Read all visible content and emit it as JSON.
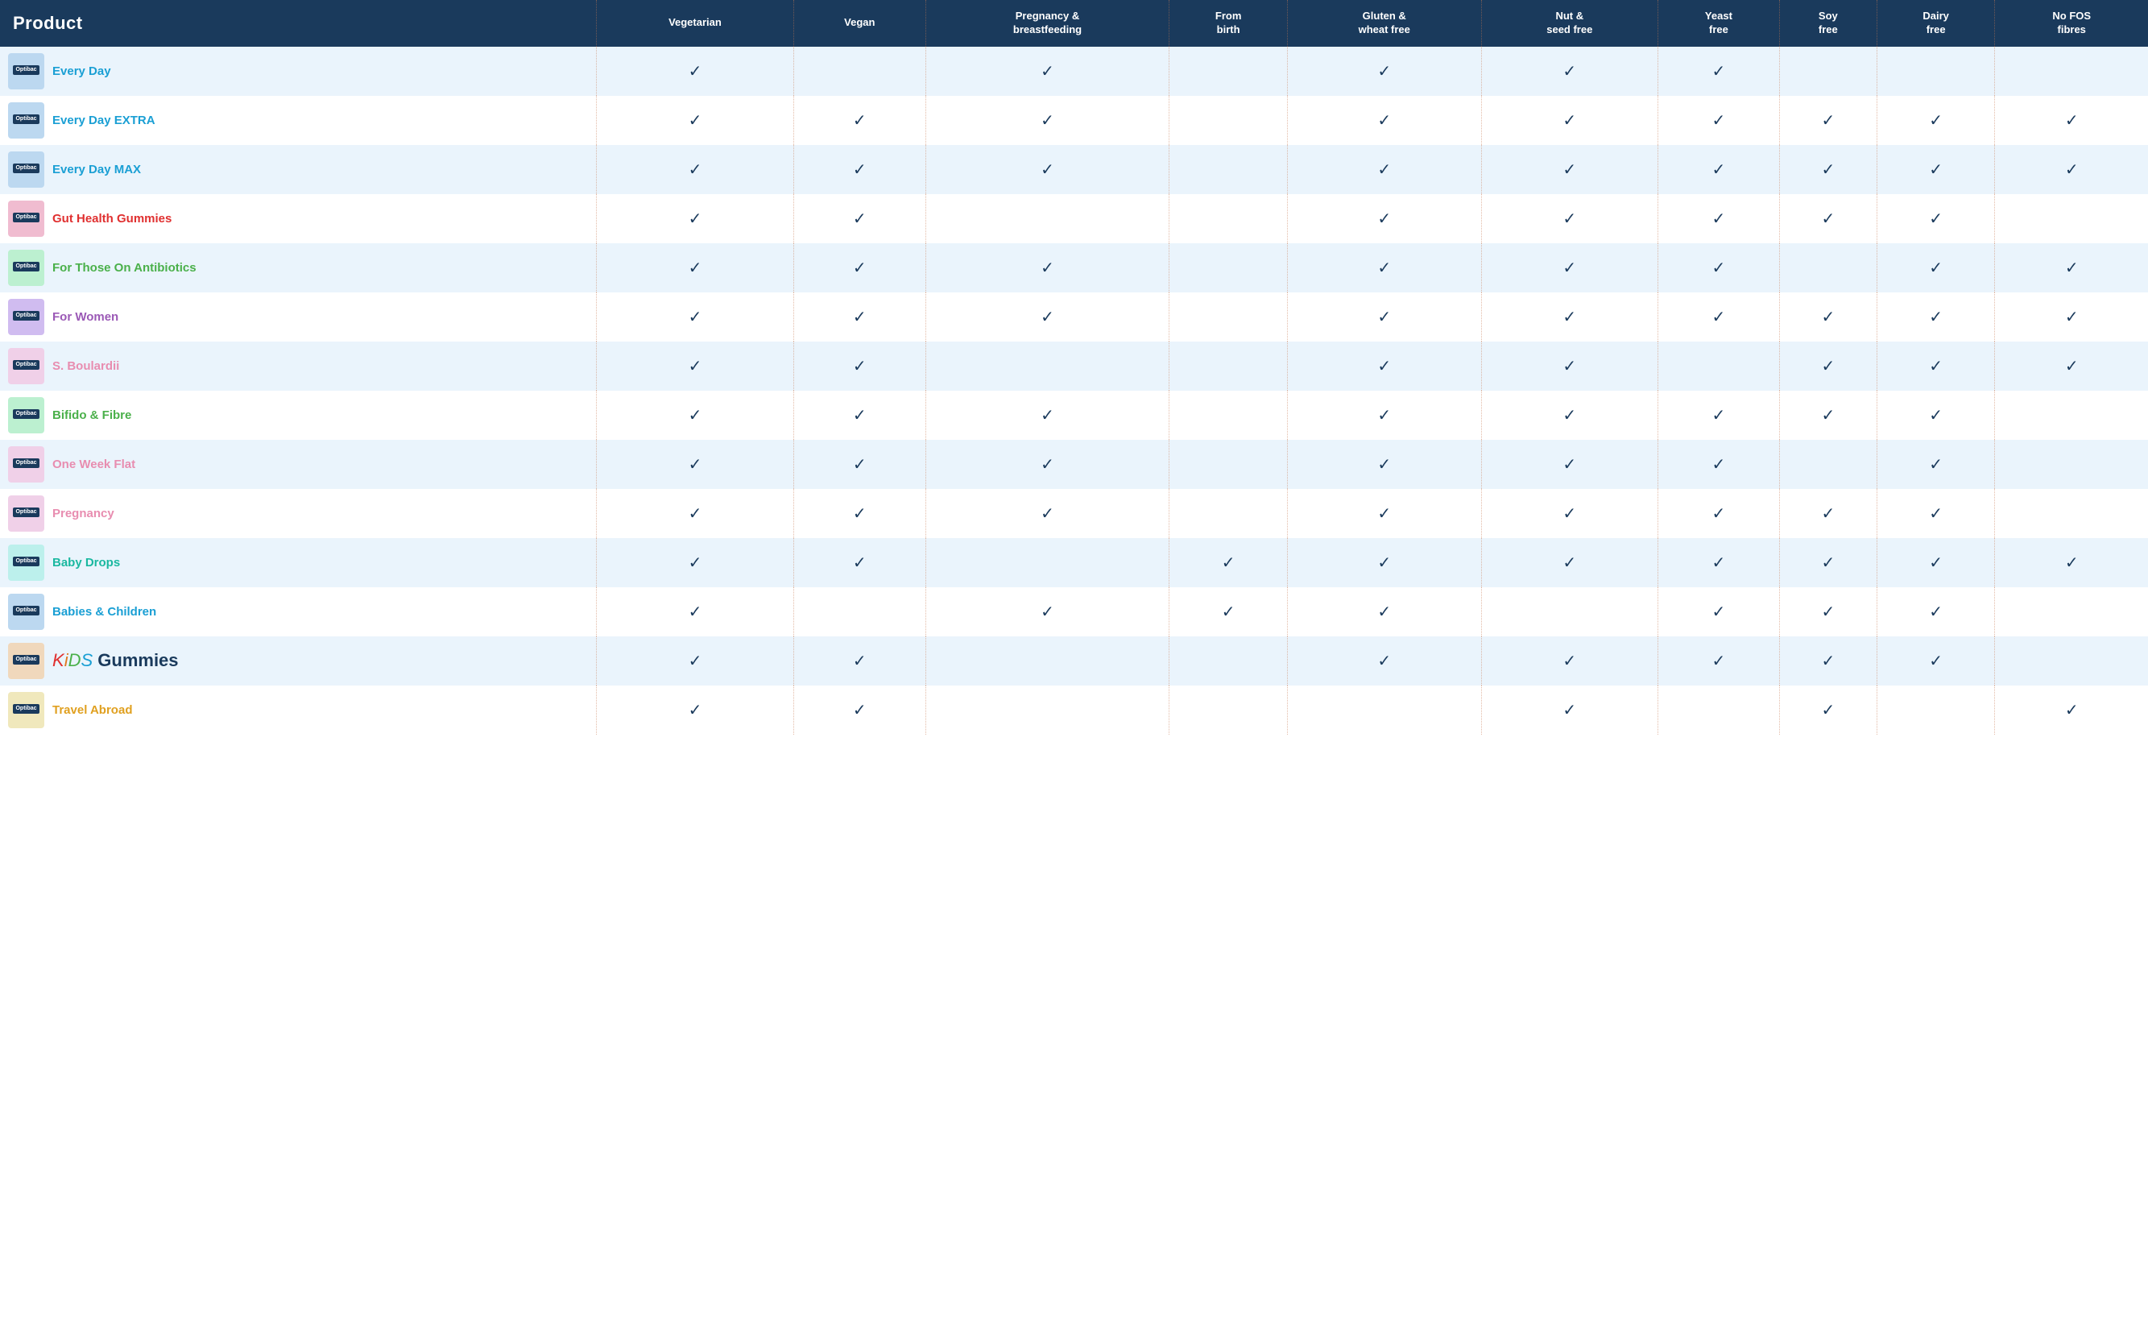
{
  "header": {
    "product_label": "Product",
    "columns": [
      {
        "key": "vegetarian",
        "label": "Vegetarian"
      },
      {
        "key": "vegan",
        "label": "Vegan"
      },
      {
        "key": "pregnancy",
        "label": "Pregnancy &\nbreastfeeding"
      },
      {
        "key": "from_birth",
        "label": "From\nbirth"
      },
      {
        "key": "gluten",
        "label": "Gluten &\nwheat free"
      },
      {
        "key": "nut",
        "label": "Nut &\nseed free"
      },
      {
        "key": "yeast",
        "label": "Yeast\nfree"
      },
      {
        "key": "soy",
        "label": "Soy\nfree"
      },
      {
        "key": "dairy",
        "label": "Dairy\nfree"
      },
      {
        "key": "fos",
        "label": "No FOS\nfibres"
      }
    ]
  },
  "products": [
    {
      "name": "Every Day",
      "color": "blue",
      "img_color": "blue",
      "vegetarian": true,
      "vegan": false,
      "pregnancy": true,
      "from_birth": false,
      "gluten": true,
      "nut": true,
      "yeast": true,
      "soy": false,
      "dairy": false,
      "fos": false
    },
    {
      "name": "Every Day EXTRA",
      "color": "blue",
      "img_color": "blue",
      "vegetarian": true,
      "vegan": true,
      "pregnancy": true,
      "from_birth": false,
      "gluten": true,
      "nut": true,
      "yeast": true,
      "soy": true,
      "dairy": true,
      "fos": true
    },
    {
      "name": "Every Day MAX",
      "color": "blue",
      "img_color": "blue",
      "vegetarian": true,
      "vegan": true,
      "pregnancy": true,
      "from_birth": false,
      "gluten": true,
      "nut": true,
      "yeast": true,
      "soy": true,
      "dairy": true,
      "fos": true
    },
    {
      "name": "Gut Health Gummies",
      "color": "red",
      "img_color": "red",
      "vegetarian": true,
      "vegan": true,
      "pregnancy": false,
      "from_birth": false,
      "gluten": true,
      "nut": true,
      "yeast": true,
      "soy": true,
      "dairy": true,
      "fos": false
    },
    {
      "name": "For Those On Antibiotics",
      "color": "green",
      "img_color": "green",
      "vegetarian": true,
      "vegan": true,
      "pregnancy": true,
      "from_birth": false,
      "gluten": true,
      "nut": true,
      "yeast": true,
      "soy": false,
      "dairy": true,
      "fos": true
    },
    {
      "name": "For Women",
      "color": "purple",
      "img_color": "purple",
      "vegetarian": true,
      "vegan": true,
      "pregnancy": true,
      "from_birth": false,
      "gluten": true,
      "nut": true,
      "yeast": true,
      "soy": true,
      "dairy": true,
      "fos": true
    },
    {
      "name": "S. Boulardii",
      "color": "pink",
      "img_color": "pink",
      "vegetarian": true,
      "vegan": true,
      "pregnancy": false,
      "from_birth": false,
      "gluten": true,
      "nut": true,
      "yeast": false,
      "soy": true,
      "dairy": true,
      "fos": true
    },
    {
      "name": "Bifido & Fibre",
      "color": "green",
      "img_color": "green",
      "vegetarian": true,
      "vegan": true,
      "pregnancy": true,
      "from_birth": false,
      "gluten": true,
      "nut": true,
      "yeast": true,
      "soy": true,
      "dairy": true,
      "fos": false
    },
    {
      "name": "One Week Flat",
      "color": "pink",
      "img_color": "pink",
      "vegetarian": true,
      "vegan": true,
      "pregnancy": true,
      "from_birth": false,
      "gluten": true,
      "nut": true,
      "yeast": true,
      "soy": false,
      "dairy": true,
      "fos": false
    },
    {
      "name": "Pregnancy",
      "color": "pink",
      "img_color": "pink",
      "vegetarian": true,
      "vegan": true,
      "pregnancy": true,
      "from_birth": false,
      "gluten": true,
      "nut": true,
      "yeast": true,
      "soy": true,
      "dairy": true,
      "fos": false
    },
    {
      "name": "Baby Drops",
      "color": "teal",
      "img_color": "teal",
      "vegetarian": true,
      "vegan": true,
      "pregnancy": false,
      "from_birth": true,
      "gluten": true,
      "nut": true,
      "yeast": true,
      "soy": true,
      "dairy": true,
      "fos": true
    },
    {
      "name": "Babies & Children",
      "color": "blue",
      "img_color": "blue",
      "vegetarian": true,
      "vegan": false,
      "pregnancy": true,
      "from_birth": true,
      "gluten": true,
      "nut": false,
      "yeast": true,
      "soy": true,
      "dairy": true,
      "fos": false
    },
    {
      "name": "KiDS Gummies",
      "color": "kids",
      "img_color": "orange",
      "vegetarian": true,
      "vegan": true,
      "pregnancy": false,
      "from_birth": false,
      "gluten": true,
      "nut": true,
      "yeast": true,
      "soy": true,
      "dairy": true,
      "fos": false
    },
    {
      "name": "Travel Abroad",
      "color": "gold",
      "img_color": "gold",
      "vegetarian": true,
      "vegan": true,
      "pregnancy": false,
      "from_birth": false,
      "gluten": false,
      "nut": true,
      "yeast": false,
      "soy": true,
      "dairy": false,
      "fos": true
    }
  ],
  "check_symbol": "✓"
}
